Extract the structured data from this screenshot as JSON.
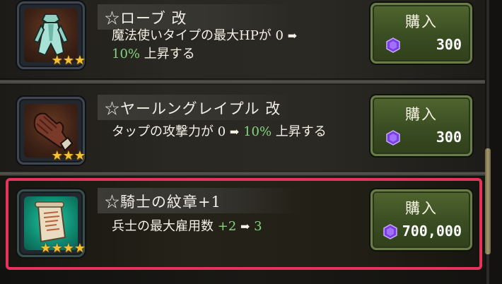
{
  "items": [
    {
      "name": "☆ローブ 改",
      "stars": "★★★",
      "desc_prefix": "魔法使いタイプの最大HPが",
      "desc_from": "0",
      "arrow": "➡",
      "desc_to": "10%",
      "desc_suffix": "上昇する",
      "buy_label": "購入",
      "price": "300"
    },
    {
      "name": "☆ヤールングレイプル 改",
      "stars": "★★★",
      "desc_prefix": "タップの攻撃力が",
      "desc_from": "0",
      "arrow": "➡",
      "desc_to": "10%",
      "desc_suffix": "上昇する",
      "buy_label": "購入",
      "price": "300"
    },
    {
      "name": "☆騎士の紋章+1",
      "stars": "★★★★",
      "desc_prefix": "兵士の最大雇用数",
      "desc_from": "+2",
      "arrow": "➡",
      "desc_to": "3",
      "desc_suffix": "",
      "buy_label": "購入",
      "price": "700,000",
      "selected": true
    }
  ],
  "icons": [
    "robe-icon",
    "glove-icon",
    "scroll-icon",
    "gem-icon"
  ],
  "colors": {
    "highlight": "#e7325e",
    "accent_green": "#84d47e",
    "buy_button": "#3a4d22",
    "star": "#f2c230"
  }
}
